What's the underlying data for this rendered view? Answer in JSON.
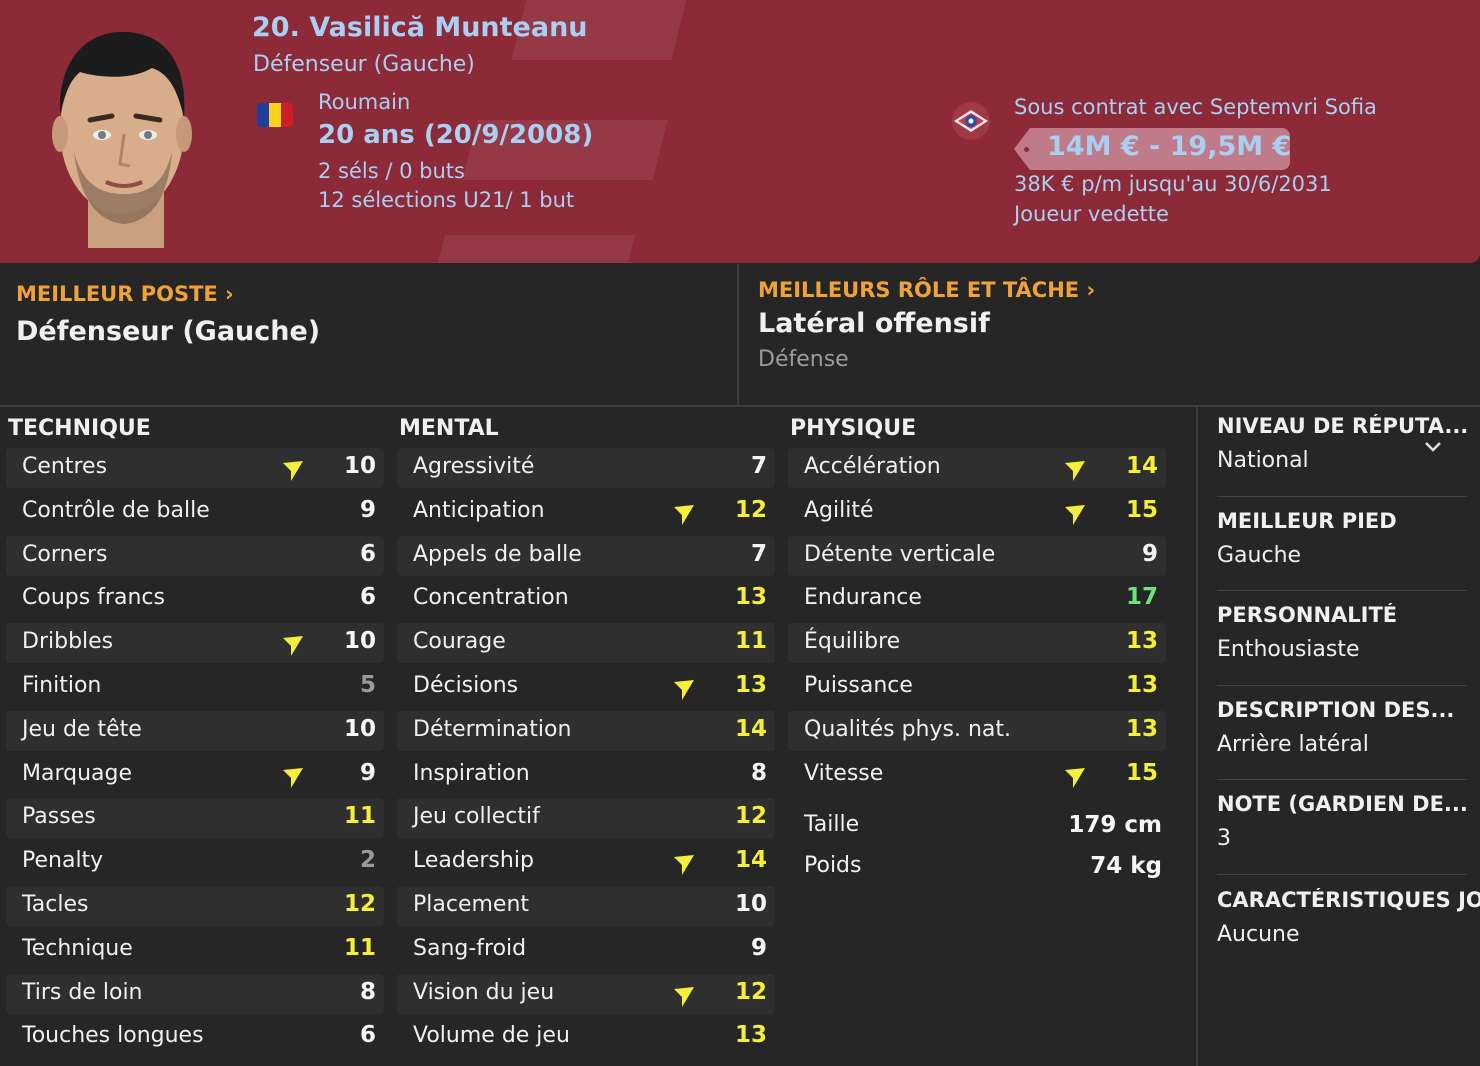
{
  "player": {
    "name": "20. Vasilică Munteanu",
    "position": "Défenseur (Gauche)",
    "nationality": "Roumain",
    "age": "20 ans (20/9/2008)",
    "caps": "2 séls / 0 buts",
    "u21": "12 sélections U21/ 1 but"
  },
  "contract": {
    "club": "Sous contrat avec Septemvri Sofia",
    "value": "14M € - 19,5M €",
    "wage": "38K € p/m jusqu'au 30/6/2031",
    "status": "Joueur vedette"
  },
  "best_position": {
    "header": "MEILLEUR POSTE",
    "value": "Défenseur (Gauche)"
  },
  "best_role": {
    "header": "MEILLEURS RÔLE ET TÂCHE",
    "value": "Latéral offensif",
    "duty": "Défense"
  },
  "colors": {
    "header_bg": "#8c2a37",
    "accent_text": "#a9cff3",
    "section_header": "#f0a23a",
    "value_yellow": "#f3ef3a",
    "value_green": "#6fe37a",
    "value_grey": "#9a9a9a"
  },
  "technique": {
    "title": "TECHNIQUE",
    "attrs": [
      {
        "label": "Centres",
        "value": "10",
        "color": "white",
        "arrow": true
      },
      {
        "label": "Contrôle de balle",
        "value": "9",
        "color": "white",
        "arrow": false
      },
      {
        "label": "Corners",
        "value": "6",
        "color": "white",
        "arrow": false
      },
      {
        "label": "Coups francs",
        "value": "6",
        "color": "white",
        "arrow": false
      },
      {
        "label": "Dribbles",
        "value": "10",
        "color": "white",
        "arrow": true
      },
      {
        "label": "Finition",
        "value": "5",
        "color": "grey",
        "arrow": false
      },
      {
        "label": "Jeu de tête",
        "value": "10",
        "color": "white",
        "arrow": false
      },
      {
        "label": "Marquage",
        "value": "9",
        "color": "white",
        "arrow": true
      },
      {
        "label": "Passes",
        "value": "11",
        "color": "yellow",
        "arrow": false
      },
      {
        "label": "Penalty",
        "value": "2",
        "color": "grey",
        "arrow": false
      },
      {
        "label": "Tacles",
        "value": "12",
        "color": "yellow",
        "arrow": false
      },
      {
        "label": "Technique",
        "value": "11",
        "color": "yellow",
        "arrow": false
      },
      {
        "label": "Tirs de loin",
        "value": "8",
        "color": "white",
        "arrow": false
      },
      {
        "label": "Touches longues",
        "value": "6",
        "color": "white",
        "arrow": false
      }
    ]
  },
  "mental": {
    "title": "MENTAL",
    "attrs": [
      {
        "label": "Agressivité",
        "value": "7",
        "color": "white",
        "arrow": false
      },
      {
        "label": "Anticipation",
        "value": "12",
        "color": "yellow",
        "arrow": true
      },
      {
        "label": "Appels de balle",
        "value": "7",
        "color": "white",
        "arrow": false
      },
      {
        "label": "Concentration",
        "value": "13",
        "color": "yellow",
        "arrow": false
      },
      {
        "label": "Courage",
        "value": "11",
        "color": "yellow",
        "arrow": false
      },
      {
        "label": "Décisions",
        "value": "13",
        "color": "yellow",
        "arrow": true
      },
      {
        "label": "Détermination",
        "value": "14",
        "color": "yellow",
        "arrow": false
      },
      {
        "label": "Inspiration",
        "value": "8",
        "color": "white",
        "arrow": false
      },
      {
        "label": "Jeu collectif",
        "value": "12",
        "color": "yellow",
        "arrow": false
      },
      {
        "label": "Leadership",
        "value": "14",
        "color": "yellow",
        "arrow": true
      },
      {
        "label": "Placement",
        "value": "10",
        "color": "white",
        "arrow": false
      },
      {
        "label": "Sang-froid",
        "value": "9",
        "color": "white",
        "arrow": false
      },
      {
        "label": "Vision du jeu",
        "value": "12",
        "color": "yellow",
        "arrow": true
      },
      {
        "label": "Volume de jeu",
        "value": "13",
        "color": "yellow",
        "arrow": false
      }
    ]
  },
  "physical": {
    "title": "PHYSIQUE",
    "attrs": [
      {
        "label": "Accélération",
        "value": "14",
        "color": "yellow",
        "arrow": true
      },
      {
        "label": "Agilité",
        "value": "15",
        "color": "yellow",
        "arrow": true
      },
      {
        "label": "Détente verticale",
        "value": "9",
        "color": "white",
        "arrow": false
      },
      {
        "label": "Endurance",
        "value": "17",
        "color": "green",
        "arrow": false
      },
      {
        "label": "Équilibre",
        "value": "13",
        "color": "yellow",
        "arrow": false
      },
      {
        "label": "Puissance",
        "value": "13",
        "color": "yellow",
        "arrow": false
      },
      {
        "label": "Qualités phys. nat.",
        "value": "13",
        "color": "yellow",
        "arrow": false
      },
      {
        "label": "Vitesse",
        "value": "15",
        "color": "yellow",
        "arrow": true
      }
    ],
    "height_label": "Taille",
    "height_value": "179 cm",
    "weight_label": "Poids",
    "weight_value": "74 kg"
  },
  "sidebar": [
    {
      "header": "NIVEAU DE RÉPUTA...",
      "value": "National"
    },
    {
      "header": "MEILLEUR PIED",
      "value": "Gauche"
    },
    {
      "header": "PERSONNALITÉ",
      "value": "Enthousiaste"
    },
    {
      "header": "DESCRIPTION DES...",
      "value": "Arrière latéral"
    },
    {
      "header": "NOTE (GARDIEN DE...",
      "value": "3"
    },
    {
      "header": "CARACTÉRISTIQUES JO",
      "value": "Aucune"
    }
  ]
}
